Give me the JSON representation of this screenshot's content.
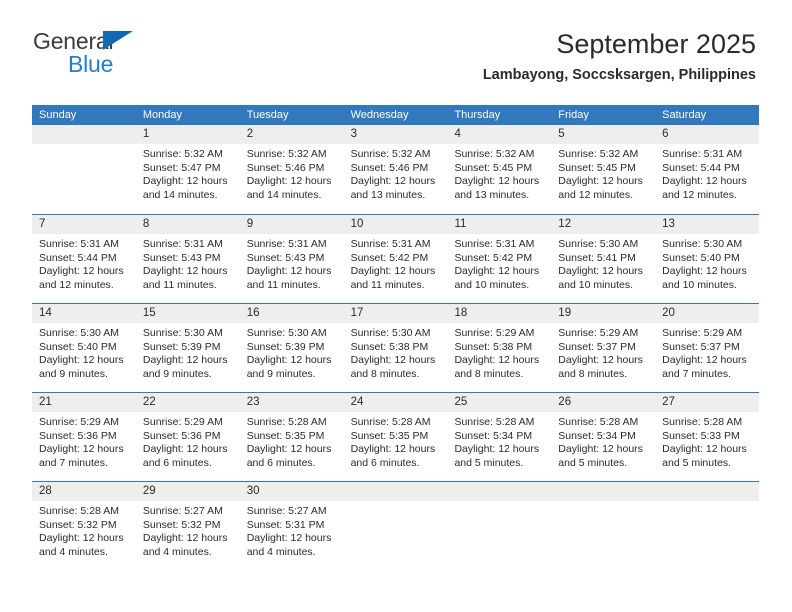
{
  "brand": {
    "name_top": "General",
    "name_bottom": "Blue",
    "triangle_icon": "triangle-logo-icon"
  },
  "header": {
    "title": "September 2025",
    "subtitle": "Lambayong, Soccsksargen, Philippines"
  },
  "colors": {
    "header_blue": "#3179bc",
    "brand_blue": "#1e7fd4",
    "triangle_blue": "#1368b3",
    "day_number_bg": "#eeeeee",
    "text": "#2b2b2b"
  },
  "weekdays": [
    "Sunday",
    "Monday",
    "Tuesday",
    "Wednesday",
    "Thursday",
    "Friday",
    "Saturday"
  ],
  "weeks": [
    [
      {
        "day": "",
        "lines": []
      },
      {
        "day": "1",
        "lines": [
          "Sunrise: 5:32 AM",
          "Sunset: 5:47 PM",
          "Daylight: 12 hours",
          "and 14 minutes."
        ]
      },
      {
        "day": "2",
        "lines": [
          "Sunrise: 5:32 AM",
          "Sunset: 5:46 PM",
          "Daylight: 12 hours",
          "and 14 minutes."
        ]
      },
      {
        "day": "3",
        "lines": [
          "Sunrise: 5:32 AM",
          "Sunset: 5:46 PM",
          "Daylight: 12 hours",
          "and 13 minutes."
        ]
      },
      {
        "day": "4",
        "lines": [
          "Sunrise: 5:32 AM",
          "Sunset: 5:45 PM",
          "Daylight: 12 hours",
          "and 13 minutes."
        ]
      },
      {
        "day": "5",
        "lines": [
          "Sunrise: 5:32 AM",
          "Sunset: 5:45 PM",
          "Daylight: 12 hours",
          "and 12 minutes."
        ]
      },
      {
        "day": "6",
        "lines": [
          "Sunrise: 5:31 AM",
          "Sunset: 5:44 PM",
          "Daylight: 12 hours",
          "and 12 minutes."
        ]
      }
    ],
    [
      {
        "day": "7",
        "lines": [
          "Sunrise: 5:31 AM",
          "Sunset: 5:44 PM",
          "Daylight: 12 hours",
          "and 12 minutes."
        ]
      },
      {
        "day": "8",
        "lines": [
          "Sunrise: 5:31 AM",
          "Sunset: 5:43 PM",
          "Daylight: 12 hours",
          "and 11 minutes."
        ]
      },
      {
        "day": "9",
        "lines": [
          "Sunrise: 5:31 AM",
          "Sunset: 5:43 PM",
          "Daylight: 12 hours",
          "and 11 minutes."
        ]
      },
      {
        "day": "10",
        "lines": [
          "Sunrise: 5:31 AM",
          "Sunset: 5:42 PM",
          "Daylight: 12 hours",
          "and 11 minutes."
        ]
      },
      {
        "day": "11",
        "lines": [
          "Sunrise: 5:31 AM",
          "Sunset: 5:42 PM",
          "Daylight: 12 hours",
          "and 10 minutes."
        ]
      },
      {
        "day": "12",
        "lines": [
          "Sunrise: 5:30 AM",
          "Sunset: 5:41 PM",
          "Daylight: 12 hours",
          "and 10 minutes."
        ]
      },
      {
        "day": "13",
        "lines": [
          "Sunrise: 5:30 AM",
          "Sunset: 5:40 PM",
          "Daylight: 12 hours",
          "and 10 minutes."
        ]
      }
    ],
    [
      {
        "day": "14",
        "lines": [
          "Sunrise: 5:30 AM",
          "Sunset: 5:40 PM",
          "Daylight: 12 hours",
          "and 9 minutes."
        ]
      },
      {
        "day": "15",
        "lines": [
          "Sunrise: 5:30 AM",
          "Sunset: 5:39 PM",
          "Daylight: 12 hours",
          "and 9 minutes."
        ]
      },
      {
        "day": "16",
        "lines": [
          "Sunrise: 5:30 AM",
          "Sunset: 5:39 PM",
          "Daylight: 12 hours",
          "and 9 minutes."
        ]
      },
      {
        "day": "17",
        "lines": [
          "Sunrise: 5:30 AM",
          "Sunset: 5:38 PM",
          "Daylight: 12 hours",
          "and 8 minutes."
        ]
      },
      {
        "day": "18",
        "lines": [
          "Sunrise: 5:29 AM",
          "Sunset: 5:38 PM",
          "Daylight: 12 hours",
          "and 8 minutes."
        ]
      },
      {
        "day": "19",
        "lines": [
          "Sunrise: 5:29 AM",
          "Sunset: 5:37 PM",
          "Daylight: 12 hours",
          "and 8 minutes."
        ]
      },
      {
        "day": "20",
        "lines": [
          "Sunrise: 5:29 AM",
          "Sunset: 5:37 PM",
          "Daylight: 12 hours",
          "and 7 minutes."
        ]
      }
    ],
    [
      {
        "day": "21",
        "lines": [
          "Sunrise: 5:29 AM",
          "Sunset: 5:36 PM",
          "Daylight: 12 hours",
          "and 7 minutes."
        ]
      },
      {
        "day": "22",
        "lines": [
          "Sunrise: 5:29 AM",
          "Sunset: 5:36 PM",
          "Daylight: 12 hours",
          "and 6 minutes."
        ]
      },
      {
        "day": "23",
        "lines": [
          "Sunrise: 5:28 AM",
          "Sunset: 5:35 PM",
          "Daylight: 12 hours",
          "and 6 minutes."
        ]
      },
      {
        "day": "24",
        "lines": [
          "Sunrise: 5:28 AM",
          "Sunset: 5:35 PM",
          "Daylight: 12 hours",
          "and 6 minutes."
        ]
      },
      {
        "day": "25",
        "lines": [
          "Sunrise: 5:28 AM",
          "Sunset: 5:34 PM",
          "Daylight: 12 hours",
          "and 5 minutes."
        ]
      },
      {
        "day": "26",
        "lines": [
          "Sunrise: 5:28 AM",
          "Sunset: 5:34 PM",
          "Daylight: 12 hours",
          "and 5 minutes."
        ]
      },
      {
        "day": "27",
        "lines": [
          "Sunrise: 5:28 AM",
          "Sunset: 5:33 PM",
          "Daylight: 12 hours",
          "and 5 minutes."
        ]
      }
    ],
    [
      {
        "day": "28",
        "lines": [
          "Sunrise: 5:28 AM",
          "Sunset: 5:32 PM",
          "Daylight: 12 hours",
          "and 4 minutes."
        ]
      },
      {
        "day": "29",
        "lines": [
          "Sunrise: 5:27 AM",
          "Sunset: 5:32 PM",
          "Daylight: 12 hours",
          "and 4 minutes."
        ]
      },
      {
        "day": "30",
        "lines": [
          "Sunrise: 5:27 AM",
          "Sunset: 5:31 PM",
          "Daylight: 12 hours",
          "and 4 minutes."
        ]
      },
      {
        "day": "",
        "lines": []
      },
      {
        "day": "",
        "lines": []
      },
      {
        "day": "",
        "lines": []
      },
      {
        "day": "",
        "lines": []
      }
    ]
  ]
}
